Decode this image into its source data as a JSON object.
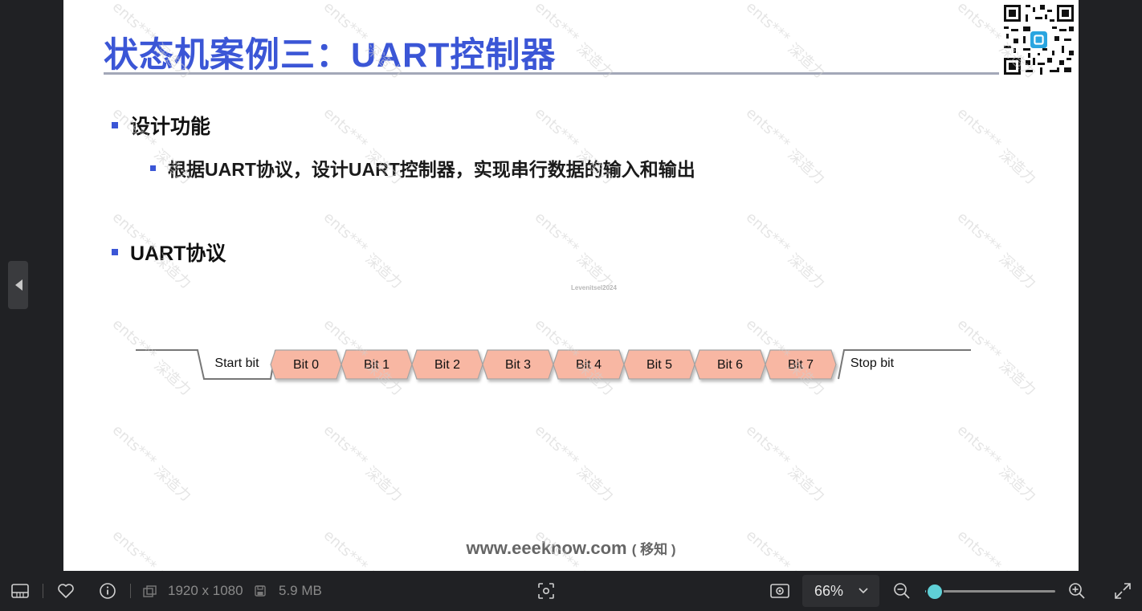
{
  "slide": {
    "title": "状态机案例三：UART控制器",
    "bullets": {
      "design_heading": "设计功能",
      "design_detail": "根据UART协议，设计UART控制器，实现串行数据的输入和输出",
      "uart_heading": "UART协议"
    },
    "frame_labels": {
      "start": "Start bit",
      "bits": [
        "Bit 0",
        "Bit 1",
        "Bit 2",
        "Bit 3",
        "Bit 4",
        "Bit 5",
        "Bit 6",
        "Bit 7"
      ],
      "stop": "Stop bit"
    },
    "small_watermark": "Levenitsel2024",
    "footer_site": "www.eeeknow.com",
    "footer_paren": "( 移知 )",
    "watermark_text_1": "ents***",
    "watermark_text_2": "深造力",
    "colors": {
      "accent": "#3b56d6",
      "bit_fill": "#f8b7a3",
      "rule": "#a3a8b8"
    }
  },
  "toolbar": {
    "dimensions": "1920 x 1080",
    "file_size": "5.9 MB",
    "zoom_label": "66%",
    "zoom_level_percent": 66,
    "icons": [
      "filmstrip-icon",
      "heart-icon",
      "info-icon",
      "dimensions-icon",
      "save-icon",
      "scan-icon",
      "fit-screen-icon",
      "chevron-down-icon",
      "zoom-out-icon",
      "zoom-in-icon",
      "fullscreen-icon"
    ]
  }
}
